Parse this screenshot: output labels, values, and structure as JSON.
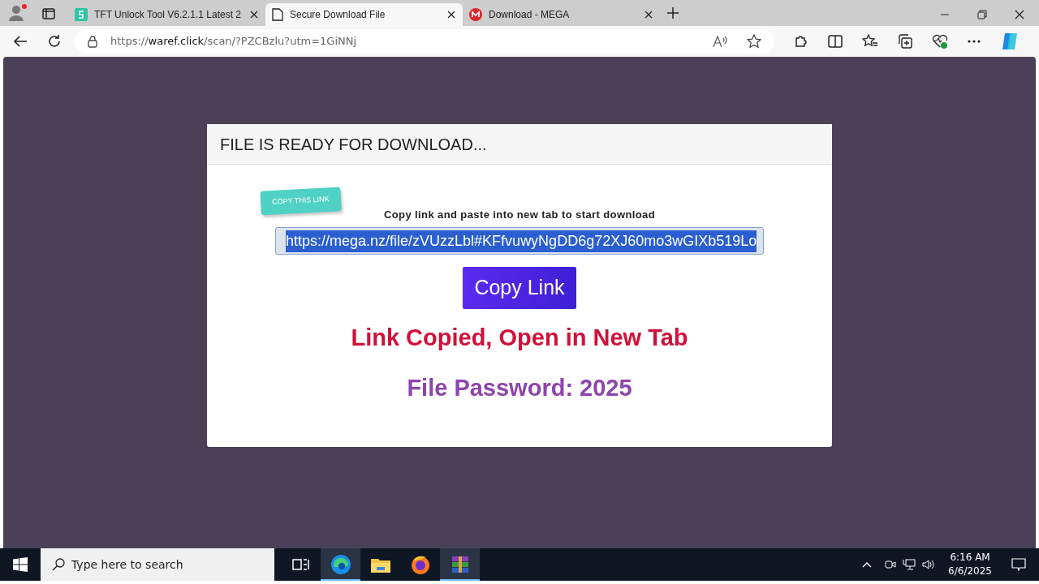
{
  "browser": {
    "tabs": [
      {
        "title": "TFT Unlock Tool V6.2.1.1 Latest 2",
        "kind": "green",
        "selected": false
      },
      {
        "title": "Secure Download File",
        "kind": "doc",
        "selected": true
      },
      {
        "title": "Download - MEGA",
        "kind": "mega",
        "selected": false
      }
    ],
    "address": {
      "scheme": "https://",
      "domain": "waref.click",
      "path": "/scan/?PZCBzlu?utm=1GiNNj"
    }
  },
  "page": {
    "header": "FILE IS READY FOR DOWNLOAD...",
    "sticker": "COPY THIS LINK",
    "instruction": "Copy link and paste into new tab to start download",
    "link": {
      "value": "https://mega.nz/file/zVUzzLbl#KFfvuwyNgDD6g72XJ60mo3wGIXb519Lo",
      "selected": true
    },
    "button": "Copy Link",
    "message": "Link Copied, Open in New Tab",
    "password": "File Password: 2025"
  },
  "taskbar": {
    "search_placeholder": "Type here to search",
    "apps": [
      {
        "kind": "taskview",
        "active": false
      },
      {
        "kind": "edge",
        "active": true
      },
      {
        "kind": "folder",
        "active": false
      },
      {
        "kind": "firefox",
        "active": false
      },
      {
        "kind": "archive",
        "active": true
      }
    ],
    "time": "6:16 AM",
    "date": "6/6/2025"
  }
}
